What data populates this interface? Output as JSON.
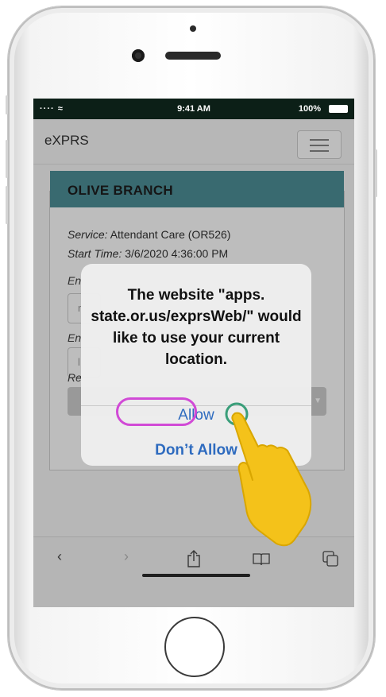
{
  "status_bar": {
    "signal": "···· ≈",
    "time": "9:41 AM",
    "battery": "100%"
  },
  "app": {
    "brand": "eXPRS"
  },
  "panel": {
    "title": "OLIVE BRANCH",
    "service_label": "Service:",
    "service_value": "Attendant Care (OR526)",
    "start_label": "Start Time:",
    "start_value": "3/6/2020 4:36:00 PM",
    "obscured_label_1": "En",
    "obscured_label_2": "En",
    "obscured_label_3": "Re",
    "obscured_input_1": "r",
    "obscured_input_2": "l"
  },
  "alert": {
    "message": "The website \"apps. state.or.us/exprsWeb/\" would like to use your current location.",
    "allow_label": "Allow",
    "deny_label": "Don’t Allow"
  },
  "toolbar": {
    "back_icon": "chevron-left-icon",
    "forward_icon": "chevron-right-icon",
    "share_icon": "share-icon",
    "bookmarks_icon": "book-icon",
    "tabs_icon": "tabs-icon"
  },
  "colors": {
    "panel_header": "#4e8f98",
    "alert_button": "#2e6bbf",
    "highlight_ring": "#d14ad6",
    "hand": "#f4c21a"
  }
}
